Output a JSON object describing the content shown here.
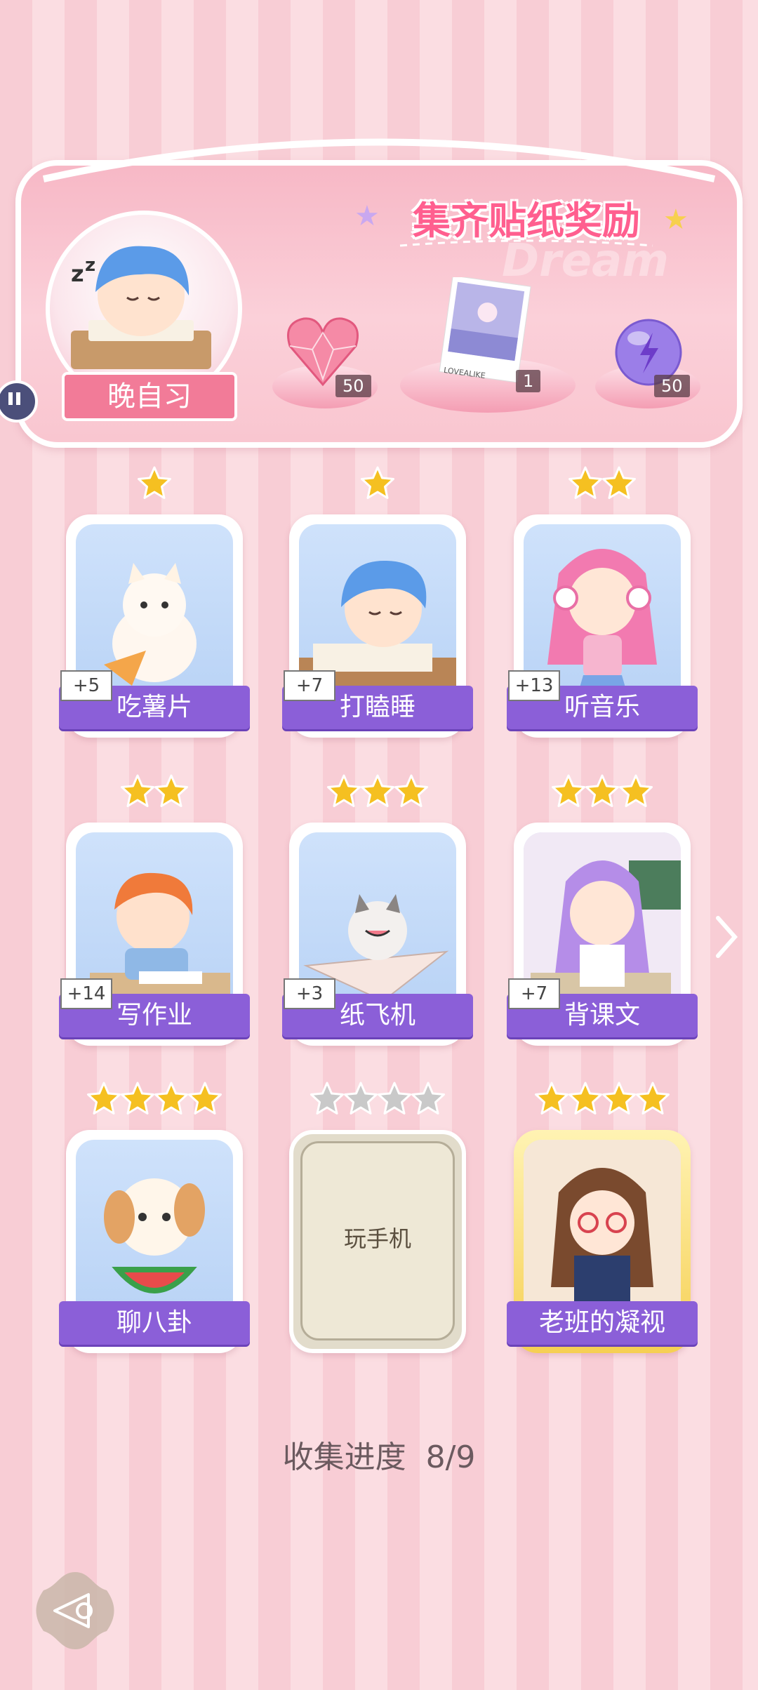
{
  "banner": {
    "title": "集齐贴纸奖励",
    "ghost_text": "Dream",
    "session_label": "晚自习",
    "rewards": [
      {
        "icon": "heart-gem-icon",
        "count": "50"
      },
      {
        "icon": "photo-card-icon",
        "count": "1"
      },
      {
        "icon": "energy-orb-icon",
        "count": "50"
      }
    ],
    "photo_caption": "LOVEALIKE"
  },
  "cards": [
    {
      "label": "吃薯片",
      "bonus": "+5",
      "stars": 1,
      "state": "collected",
      "icon": "cat-eating-chips-icon"
    },
    {
      "label": "打瞌睡",
      "bonus": "+7",
      "stars": 1,
      "state": "collected",
      "icon": "sleeping-boy-icon"
    },
    {
      "label": "听音乐",
      "bonus": "+13",
      "stars": 2,
      "state": "collected",
      "icon": "music-girl-icon"
    },
    {
      "label": "写作业",
      "bonus": "+14",
      "stars": 2,
      "state": "collected",
      "icon": "homework-boy-icon"
    },
    {
      "label": "纸飞机",
      "bonus": "+3",
      "stars": 3,
      "state": "collected",
      "icon": "paper-plane-cat-icon"
    },
    {
      "label": "背课文",
      "bonus": "+7",
      "stars": 3,
      "state": "collected",
      "icon": "reading-girl-icon"
    },
    {
      "label": "聊八卦",
      "bonus": "",
      "stars": 4,
      "state": "collected",
      "icon": "puppy-watermelon-icon"
    },
    {
      "label": "玩手机",
      "bonus": "",
      "stars": 4,
      "state": "locked",
      "icon": "locked-card-icon"
    },
    {
      "label": "老班的凝视",
      "bonus": "",
      "stars": 4,
      "state": "gold",
      "icon": "teacher-stare-icon"
    }
  ],
  "progress": {
    "label": "收集进度",
    "value": "8/9"
  },
  "colors": {
    "accent": "#8b5fd8",
    "pink": "#f27b98",
    "star": "#f5c021"
  }
}
